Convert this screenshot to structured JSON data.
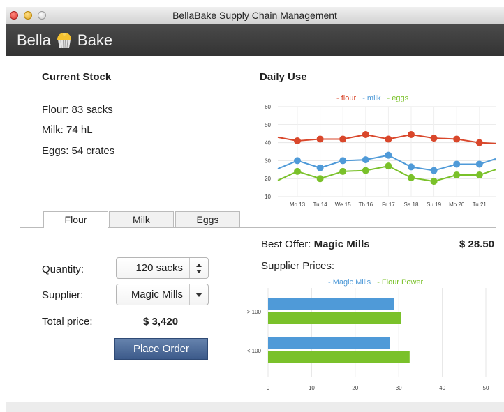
{
  "window": {
    "title": "BellaBake Supply Chain Management"
  },
  "brand": {
    "left": "Bella",
    "right": "Bake"
  },
  "stock": {
    "title": "Current Stock",
    "flour": "Flour: 83 sacks",
    "milk": "Milk: 74 hL",
    "eggs": "Eggs: 54 crates"
  },
  "tabs": [
    {
      "label": "Flour",
      "active": true
    },
    {
      "label": "Milk",
      "active": false
    },
    {
      "label": "Eggs",
      "active": false
    }
  ],
  "order": {
    "quantity_label": "Quantity:",
    "quantity_value": "120 sacks",
    "supplier_label": "Supplier:",
    "supplier_value": "Magic Mills",
    "total_label": "Total price:",
    "total_value": "$ 3,420",
    "button_label": "Place Order"
  },
  "offer": {
    "prefix": "Best Offer: ",
    "supplier": "Magic Mills",
    "price": "$ 28.50",
    "prices_title": "Supplier Prices:"
  },
  "colors": {
    "flour": "#d9472b",
    "milk": "#4f9ad8",
    "eggs": "#7ac12a",
    "magic_mills": "#4f9ad8",
    "flour_power": "#7ac12a"
  },
  "chart_data": [
    {
      "type": "line",
      "title": "Daily Use",
      "categories": [
        "Mo 13",
        "Tu 14",
        "We 15",
        "Th 16",
        "Fr 17",
        "Sa 18",
        "Su 19",
        "Mo 20",
        "Tu 21"
      ],
      "ylim": [
        10,
        60
      ],
      "yticks": [
        10,
        20,
        30,
        40,
        50,
        60
      ],
      "legend": [
        "- flour",
        "- milk",
        "- eggs"
      ],
      "series": [
        {
          "name": "flour",
          "values": [
            41,
            42,
            42,
            44.5,
            42,
            44.5,
            42.5,
            42,
            40
          ],
          "start": 43,
          "end": 39.5
        },
        {
          "name": "milk",
          "values": [
            30,
            26,
            30,
            30.5,
            33,
            26.5,
            24.5,
            28,
            28
          ],
          "start": 25.5,
          "end": 31
        },
        {
          "name": "eggs",
          "values": [
            24,
            20,
            24,
            24.5,
            27,
            20.5,
            18.5,
            22,
            22
          ],
          "start": 19,
          "end": 25
        }
      ],
      "grid": true
    },
    {
      "type": "bar",
      "orientation": "horizontal",
      "categories": [
        "> 100",
        "< 100"
      ],
      "legend": [
        "- Magic Mills",
        "- Flour Power"
      ],
      "series": [
        {
          "name": "Magic Mills",
          "values": [
            29,
            28
          ]
        },
        {
          "name": "Flour Power",
          "values": [
            30.5,
            32.5
          ]
        }
      ],
      "xlim": [
        0,
        50
      ],
      "xticks": [
        0,
        10,
        20,
        30,
        40,
        50
      ],
      "grid": true
    }
  ]
}
